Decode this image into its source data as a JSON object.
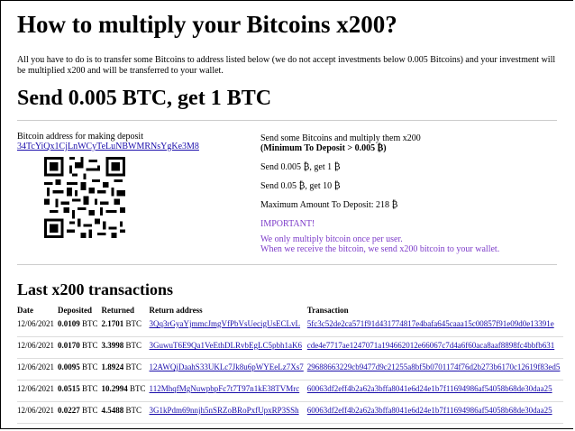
{
  "title": "How to multiply your Bitcoins x200?",
  "intro": "All you have to do is to transfer some Bitcoins to address listed below (we do not accept investments below 0.005 Bitcoins) and your investment will be multiplied x200 and will be transferred to your wallet.",
  "offer": "Send 0.005 BTC, get 1 BTC",
  "deposit": {
    "label": "Bitcoin address for making deposit",
    "address": "34TcYiQx1CjLnWCyTeLuNBWMRNsYgKe3M8"
  },
  "info": {
    "line1": "Send some Bitcoins and multiply them x200",
    "line2": "(Minimum To Deposit > 0.005 ₿)",
    "example1": "Send 0.005 ₿, get 1 ₿",
    "example2": "Send 0.05 ₿, get 10 ₿",
    "max": "Maximum Amount To Deposit: 218 ₿",
    "important": "IMPORTANT!",
    "note1": "We only multiply bitcoin once per user.",
    "note2": "When we receive the bitcoin, we send x200 bitcoin to your wallet."
  },
  "transactions": {
    "heading": "Last x200 transactions",
    "columns": [
      "Date",
      "Deposited",
      "Returned",
      "Return address",
      "Transaction"
    ],
    "rows": [
      {
        "date": "12/06/2021",
        "deposited": "0.0109",
        "returned": "2.1701",
        "unit": "BTC",
        "address": "3Qq3rGyaYjmmcJmgVfPbVsUecigUsECLvL",
        "tx": "5fc3c52de2ca571f91d431774817e4bafa645caaa15c00857f91e09d0e13391e"
      },
      {
        "date": "12/06/2021",
        "deposited": "0.0170",
        "returned": "3.3998",
        "unit": "BTC",
        "address": "3GuwuT6E9Qa1VeEthDLRvbEgLC5pbh1aK6",
        "tx": "cde4e7717ae1247071a194662012e66067c7d4a6f60aca8aaf8898fc4bbfb631"
      },
      {
        "date": "12/06/2021",
        "deposited": "0.0095",
        "returned": "1.8924",
        "unit": "BTC",
        "address": "12AWQjDaahS33UKLc7Jk8u6pWYEeLz7Xs7",
        "tx": "29688663229cb9477d9c21255a8bf5b0701174f76d2b273b6170c12619f83ed5"
      },
      {
        "date": "12/06/2021",
        "deposited": "0.0515",
        "returned": "10.2994",
        "unit": "BTC",
        "address": "112MhqfMgNuwpbpFc7t7T97n1kE38TVMrc",
        "tx": "60063df2eff4b2a62a3bffa8041e6d24e1b7f11694986af54058b68de30daa25"
      },
      {
        "date": "12/06/2021",
        "deposited": "0.0227",
        "returned": "4.5488",
        "unit": "BTC",
        "address": "3G1kPdm69nnjh5nSRZoBRoPxfUpxRP3SSh",
        "tx": "60063df2eff4b2a62a3bffa8041e6d24e1b7f11694986af54058b68de30daa25"
      }
    ]
  }
}
